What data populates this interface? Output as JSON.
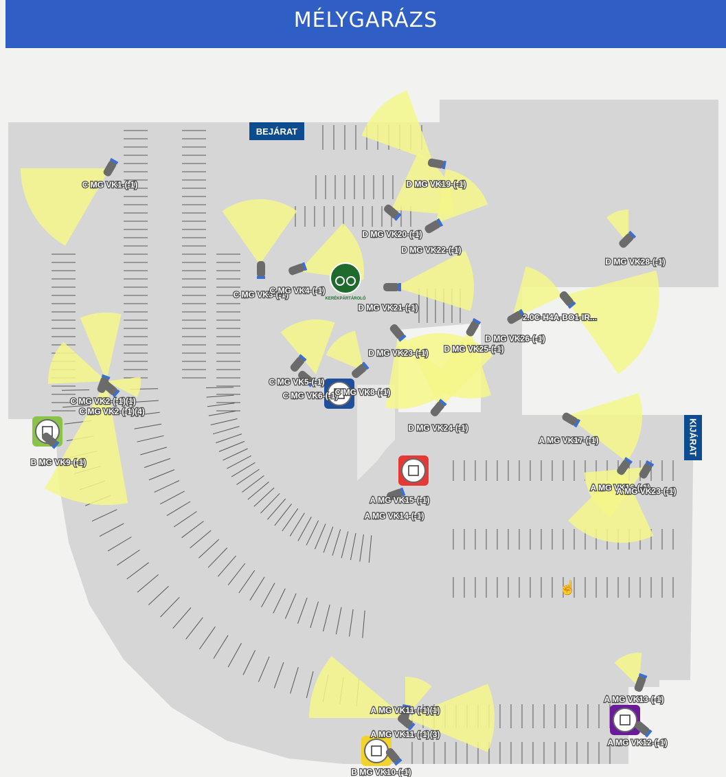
{
  "header": {
    "title": "MÉLYGARÁZS"
  },
  "signs": {
    "entrance": "BEJÁRAT",
    "exit": "KIJÁRAT"
  },
  "bike": {
    "label": "KERÉKPÁRTÁROLÓ"
  },
  "colors": {
    "header": "#2f5fc4",
    "floor": "#d6d6d6",
    "sign": "#0d4c8f",
    "fov": "#f4f78a",
    "camera": "#6b6b6b",
    "camera_lens": "#3b6fd1",
    "bike": "#1f6b2e",
    "stair_green": "#8bc34a",
    "stair_blue": "#1d4f9c",
    "stair_red": "#e53935",
    "stair_purple": "#6a1b9a",
    "stair_yellow": "#f2d32b"
  },
  "cameras": [
    {
      "label": "C MG VK1-(-1)"
    },
    {
      "label": "D MG VK19-(-1)"
    },
    {
      "label": "D MG VK20-(-1)"
    },
    {
      "label": "D MG VK22-(-1)"
    },
    {
      "label": "D MG VK28-(-1)"
    },
    {
      "label": "C MG VK3-(-1)"
    },
    {
      "label": "C MG VK4-(-1)"
    },
    {
      "label": "D MG VK21-(-1)"
    },
    {
      "label": "2.0C-H4A-BO1-IR..."
    },
    {
      "label": "D MG VK26-(-1)"
    },
    {
      "label": "D MG VK23-(-1)"
    },
    {
      "label": "D MG VK25-(-1)"
    },
    {
      "label": "C MG VK5-(-1)"
    },
    {
      "label": "C MG VK6-(-1)"
    },
    {
      "label": "C MG VK8-(-1)"
    },
    {
      "label": "C MG VK2-(-1)(1)"
    },
    {
      "label": "C MG VK2-(-1)(4)"
    },
    {
      "label": "B MG VK9-(-1)"
    },
    {
      "label": "D MG VK24-(-1)"
    },
    {
      "label": "A MG VK17-(-1)"
    },
    {
      "label": "A MG VK15-(-1)"
    },
    {
      "label": "A MG VK14-(-1)"
    },
    {
      "label": "A MG VK16-(-1)"
    },
    {
      "label": "A MG VK23-(-1)"
    },
    {
      "label": "A MG VK11-(-1)(1)"
    },
    {
      "label": "A MG VK11-(-1)(3)"
    },
    {
      "label": "A MG VK13-(-1)"
    },
    {
      "label": "A MG VK12-(-1)"
    },
    {
      "label": "B MG VK10-(-1)"
    }
  ]
}
